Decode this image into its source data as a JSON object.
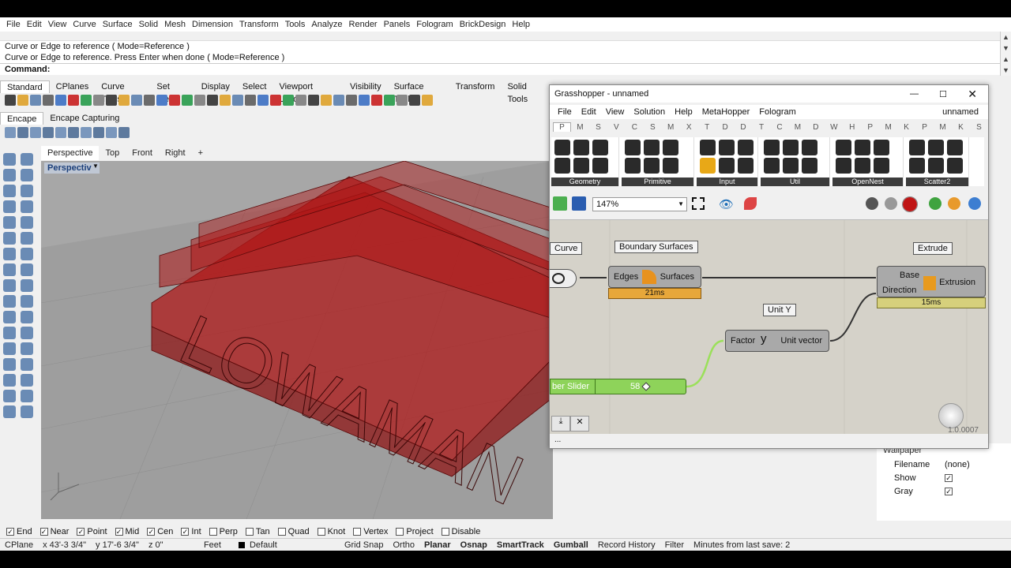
{
  "rhino": {
    "menu": [
      "File",
      "Edit",
      "View",
      "Curve",
      "Surface",
      "Solid",
      "Mesh",
      "Dimension",
      "Transform",
      "Tools",
      "Analyze",
      "Render",
      "Panels",
      "Fologram",
      "BrickDesign",
      "Help"
    ],
    "history": [
      "Curve or Edge to reference ( Mode=Reference )",
      "Curve or Edge to reference. Press Enter when done ( Mode=Reference )"
    ],
    "command_label": "Command:",
    "toolbar_tabs": [
      "Standard",
      "CPlanes",
      "Curve Tools",
      "Set View",
      "Display",
      "Select",
      "Viewport Layout",
      "Visibility",
      "Surface Tools",
      "Transform",
      "Solid Tools"
    ],
    "plugin_tabs": [
      "Encape",
      "Encape Capturing"
    ],
    "view_tabs": [
      "Perspective",
      "Top",
      "Front",
      "Right"
    ],
    "viewport_label": "Perspective",
    "viewport_text": "LOWAMAN",
    "osnaps": [
      {
        "label": "End",
        "checked": true
      },
      {
        "label": "Near",
        "checked": true
      },
      {
        "label": "Point",
        "checked": true
      },
      {
        "label": "Mid",
        "checked": true
      },
      {
        "label": "Cen",
        "checked": true
      },
      {
        "label": "Int",
        "checked": true
      },
      {
        "label": "Perp",
        "checked": false
      },
      {
        "label": "Tan",
        "checked": false
      },
      {
        "label": "Quad",
        "checked": false
      },
      {
        "label": "Knot",
        "checked": false
      },
      {
        "label": "Vertex",
        "checked": false
      },
      {
        "label": "Project",
        "checked": false
      },
      {
        "label": "Disable",
        "checked": false
      }
    ],
    "status": {
      "cplane": "CPlane",
      "x": "x 43'-3 3/4\"",
      "y": "y 17'-6 3/4\"",
      "z": "z 0\"",
      "units": "Feet",
      "layer": "Default",
      "grid_snap": "Grid Snap",
      "ortho": "Ortho",
      "planar": "Planar",
      "osnap": "Osnap",
      "smarttrack": "SmartTrack",
      "gumball": "Gumball",
      "record_history": "Record History",
      "filter": "Filter",
      "minutes": "Minutes from last save: 2"
    },
    "properties": {
      "section": "Wallpaper",
      "rows": [
        {
          "label": "Filename",
          "value": "(none)"
        },
        {
          "label": "Show",
          "value": "✓"
        },
        {
          "label": "Gray",
          "value": "✓"
        }
      ]
    }
  },
  "gh": {
    "title": "Grasshopper - unnamed",
    "doc_name": "unnamed",
    "menu": [
      "File",
      "Edit",
      "View",
      "Solution",
      "Help",
      "MetaHopper",
      "Fologram"
    ],
    "tabs": [
      "P",
      "M",
      "S",
      "V",
      "C",
      "S",
      "M",
      "X",
      "T",
      "D",
      "D",
      "T",
      "C",
      "M",
      "D",
      "W",
      "H",
      "P",
      "M",
      "K",
      "P",
      "M",
      "K",
      "S"
    ],
    "groups": [
      "Geometry",
      "Primitive",
      "Input",
      "Util",
      "OpenNest",
      "Scatter2"
    ],
    "zoom": "147%",
    "version": "1.0.0007",
    "footer_text": "...",
    "components": {
      "curve_tag": "Curve",
      "boundary_tag": "Boundary Surfaces",
      "boundary_in": "Edges",
      "boundary_out": "Surfaces",
      "boundary_time": "21ms",
      "unity_tag": "Unit Y",
      "unity_in": "Factor",
      "unity_out": "Unit vector",
      "unity_glyph": "y",
      "extrude_tag": "Extrude",
      "extrude_in1": "Base",
      "extrude_in2": "Direction",
      "extrude_out": "Extrusion",
      "extrude_time": "15ms",
      "slider_label": "ber Slider",
      "slider_value": "58"
    }
  }
}
